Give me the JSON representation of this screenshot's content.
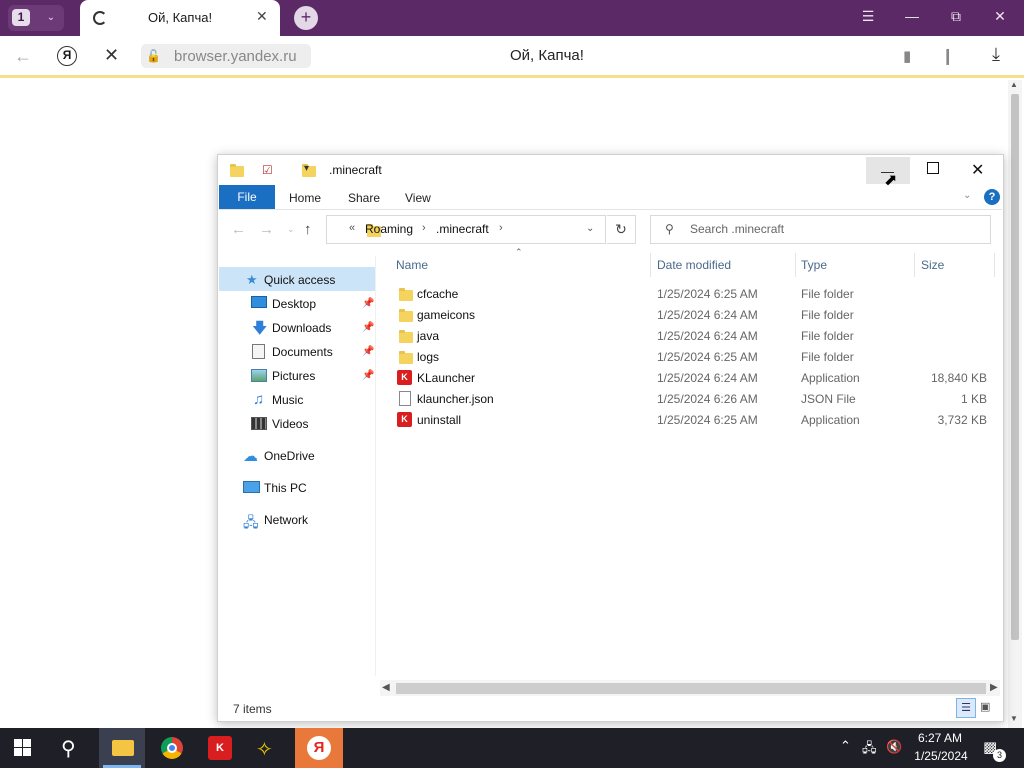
{
  "browser": {
    "tab_count": "1",
    "tab_title": "Ой, Капча!",
    "url": "browser.yandex.ru",
    "page_title": "Ой, Капча!",
    "logo_letter": "Я"
  },
  "explorer": {
    "window_title": ".minecraft",
    "ribbon_tabs": [
      "File",
      "Home",
      "Share",
      "View"
    ],
    "path_prefix": "«",
    "path": [
      "Roaming",
      ".minecraft"
    ],
    "search_placeholder": "Search .minecraft",
    "nav": {
      "quick_access": "Quick access",
      "items": [
        "Desktop",
        "Downloads",
        "Documents",
        "Pictures",
        "Music",
        "Videos"
      ],
      "onedrive": "OneDrive",
      "thispc": "This PC",
      "network": "Network"
    },
    "columns": [
      "Name",
      "Date modified",
      "Type",
      "Size"
    ],
    "files": [
      {
        "name": "cfcache",
        "date": "1/25/2024 6:25 AM",
        "type": "File folder",
        "size": "",
        "icon": "folder-icon"
      },
      {
        "name": "gameicons",
        "date": "1/25/2024 6:24 AM",
        "type": "File folder",
        "size": "",
        "icon": "folder-icon"
      },
      {
        "name": "java",
        "date": "1/25/2024 6:24 AM",
        "type": "File folder",
        "size": "",
        "icon": "folder-icon"
      },
      {
        "name": "logs",
        "date": "1/25/2024 6:25 AM",
        "type": "File folder",
        "size": "",
        "icon": "folder-icon"
      },
      {
        "name": "KLauncher",
        "date": "1/25/2024 6:24 AM",
        "type": "Application",
        "size": "18,840 KB",
        "icon": "klauncher-app-icon"
      },
      {
        "name": "klauncher.json",
        "date": "1/25/2024 6:26 AM",
        "type": "JSON File",
        "size": "1 KB",
        "icon": "json-file-icon"
      },
      {
        "name": "uninstall",
        "date": "1/25/2024 6:25 AM",
        "type": "Application",
        "size": "3,732 KB",
        "icon": "klauncher-app-icon"
      }
    ],
    "status": "7 items",
    "app_icon_letter": "K"
  },
  "taskbar": {
    "time": "6:27 AM",
    "date": "1/25/2024",
    "notifications": "3",
    "klauncher_label": "K"
  },
  "colors": {
    "tabbar": "#5b2a66",
    "accent_blue": "#1a6fc2",
    "selection": "#cce4f7",
    "taskbar": "#1f1f28",
    "yandex_active": "#e8793a"
  }
}
